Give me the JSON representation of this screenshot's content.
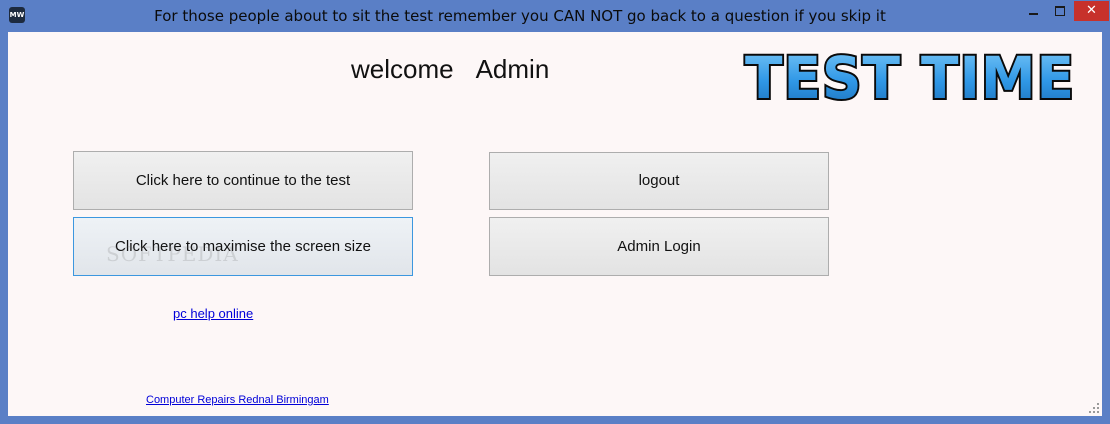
{
  "window": {
    "title": "For those people about to sit the test remember you CAN NOT go back to a question if you skip it",
    "icon_label": "MW",
    "icon": "app-icon",
    "controls": {
      "minimize_icon": "minimize-icon",
      "maximize_icon": "maximize-icon",
      "close_label": "✕"
    },
    "titlebar_color": "#5a7fc6",
    "close_color": "#c7312b"
  },
  "header": {
    "welcome_word": "welcome",
    "username": "Admin",
    "logo_text": "TEST TIME"
  },
  "buttons": {
    "continue_label": "Click here to continue to the test",
    "maximise_label": "Click here to maximise the screen size",
    "logout_label": "logout",
    "admin_login_label": "Admin Login"
  },
  "links": {
    "help_label": "pc help online",
    "repairs_label": "Computer Repairs Rednal Birmingam"
  },
  "watermark": "SOFTPEDIA",
  "colors": {
    "background": "#fdf7f7",
    "link": "#0000d8",
    "logo_fill": "#3aa6ee",
    "logo_outline": "#0a0a0a",
    "focus_border": "#3c97df"
  }
}
